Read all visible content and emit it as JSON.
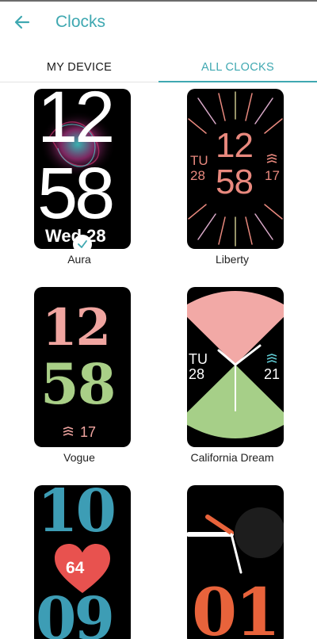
{
  "header": {
    "title": "Clocks"
  },
  "tabs": [
    {
      "label": "MY DEVICE"
    },
    {
      "label": "ALL CLOCKS"
    }
  ],
  "clocks": [
    {
      "name": "Aura",
      "face": {
        "hour": "12",
        "minute": "58",
        "date": "Wed 28"
      },
      "selected": true
    },
    {
      "name": "Liberty",
      "face": {
        "hour": "12",
        "minute": "58",
        "day": "TU",
        "date": "28",
        "stat": "17"
      }
    },
    {
      "name": "Vogue",
      "face": {
        "hour": "12",
        "minute": "58",
        "stat": "17"
      }
    },
    {
      "name": "California Dream",
      "face": {
        "day": "TU",
        "date": "28",
        "stat": "21"
      }
    },
    {
      "name": "",
      "face": {
        "hour": "10",
        "heart": "64",
        "minute": "09"
      }
    },
    {
      "name": "",
      "face": {
        "digits": "01"
      }
    }
  ],
  "colors": {
    "accent": "#3fa8b1",
    "liberty": "#e9897e",
    "vogue_pink": "#f0a5a0",
    "vogue_green": "#a9cf87",
    "cali_pink": "#f2a9a6",
    "cali_green": "#a6cf88",
    "blue_face": "#3d9db5",
    "heart": "#e8524f",
    "orange": "#e8633b"
  },
  "icons": {
    "back": "arrow-left-icon",
    "selected": "check-icon",
    "stat": "wave-icon"
  }
}
